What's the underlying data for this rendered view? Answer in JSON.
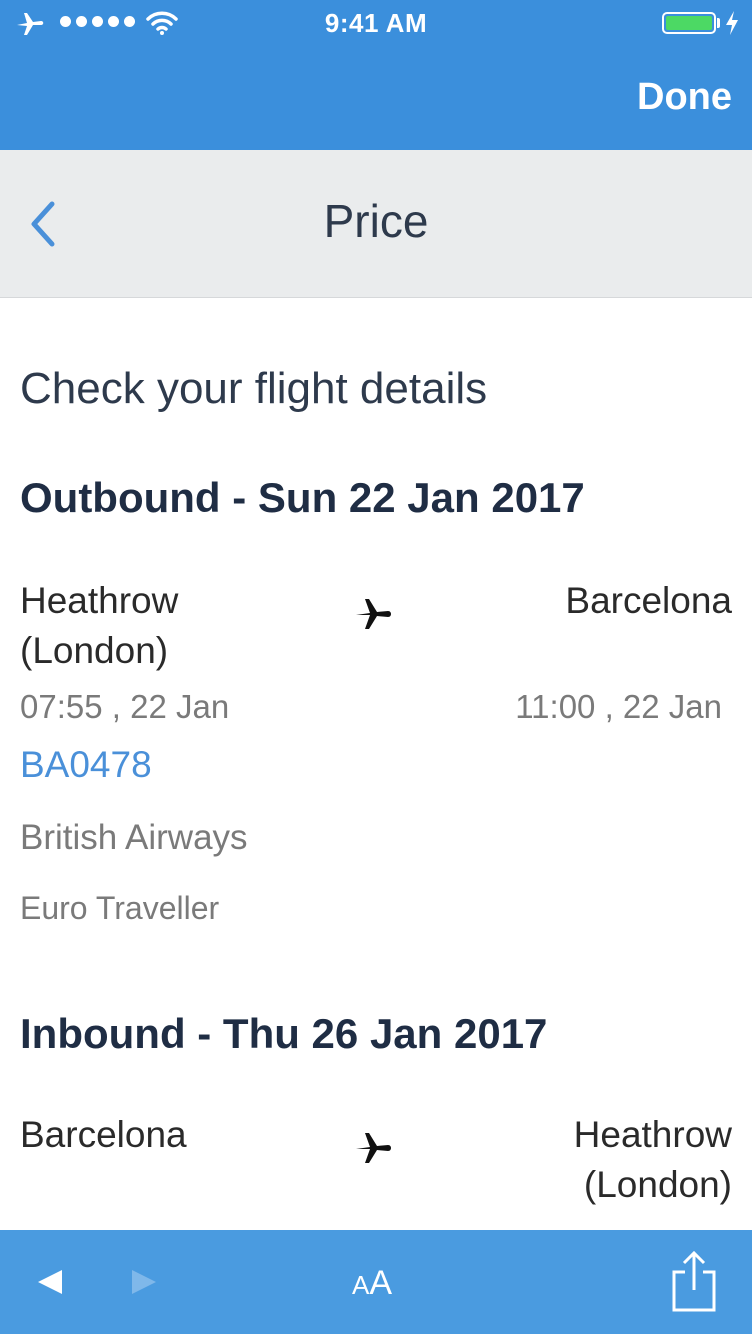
{
  "status_bar": {
    "time": "9:41 AM",
    "icons": [
      "airplane-mode-icon",
      "signal-dots-icon",
      "wifi-icon",
      "battery-icon",
      "charging-bolt-icon"
    ],
    "battery_level": 1.0
  },
  "top_bar": {
    "done_label": "Done"
  },
  "nav": {
    "title": "Price",
    "back_icon": "chevron-left-icon"
  },
  "page": {
    "heading": "Check your flight details"
  },
  "outbound": {
    "title": "Outbound - Sun 22 Jan 2017",
    "from_line1": "Heathrow",
    "from_line2": "(London)",
    "to": "Barcelona",
    "depart_time": "07:55 , 22 Jan",
    "arrive_time": "11:00 , 22 Jan",
    "flight_number": "BA0478",
    "airline": "British Airways",
    "cabin": "Euro Traveller"
  },
  "inbound": {
    "title": "Inbound - Thu 26 Jan 2017",
    "from": "Barcelona",
    "to_line1": "Heathrow",
    "to_line2": "(London)"
  },
  "toolbar": {
    "text_size_label_big": "A",
    "text_size_label_small": "A",
    "icons": [
      "back-arrow-icon",
      "forward-arrow-icon",
      "text-size-icon",
      "share-icon"
    ]
  },
  "colors": {
    "accent_blue": "#3b8fdc",
    "toolbar_blue": "#4a9be0",
    "nav_gray": "#eaeced",
    "link_blue": "#4a90d9",
    "heading_navy": "#1f2d44"
  }
}
